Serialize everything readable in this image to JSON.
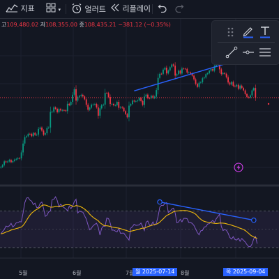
{
  "toolbar": {
    "indicators_label": "지표",
    "alert_label": "얼러트",
    "replay_label": "리플레이"
  },
  "ohlc": {
    "high_prefix": "고",
    "high_value": "109,480.02",
    "low_prefix": "저",
    "low_value": "108,355.00",
    "close_prefix": "종",
    "close_value": "108,435.21",
    "change": "−381.12",
    "change_pct": "(−0.35%)"
  },
  "colors": {
    "background": "#131722",
    "up": "#089981",
    "down": "#f23645",
    "trendline": "#2962ff",
    "rsi_line": "#7e57c2",
    "rsi_ma": "#f0b90b",
    "rsi_band": "#7e57c2"
  },
  "time_axis": {
    "labels": [
      "5월",
      "6월",
      "7월",
      "8월"
    ],
    "left_badge": "월 2025-07-14",
    "right_badge": "목 2025-09-04"
  },
  "icons": [
    "chart-indicators-icon",
    "templates-icon",
    "alarm-clock-icon",
    "replay-icon",
    "undo-icon",
    "redo-icon",
    "grip-icon",
    "pencil-icon",
    "text-icon",
    "trendline-icon",
    "horizontal-ray-icon",
    "fib-icon",
    "lightning-icon"
  ],
  "chart_data": {
    "type": "candlestick",
    "title": "",
    "xlabel": "",
    "ylabel": "",
    "x": [
      "2025-04-09",
      "2025-04-10",
      "2025-04-11",
      "2025-04-12",
      "2025-04-13",
      "2025-04-14",
      "2025-04-15",
      "2025-04-16",
      "2025-04-17",
      "2025-04-18",
      "2025-04-19",
      "2025-04-20",
      "2025-04-21",
      "2025-04-22",
      "2025-04-23",
      "2025-04-24",
      "2025-04-25",
      "2025-04-26",
      "2025-04-27",
      "2025-04-28",
      "2025-04-29",
      "2025-04-30",
      "2025-05-01",
      "2025-05-02",
      "2025-05-03",
      "2025-05-04",
      "2025-05-05",
      "2025-05-06",
      "2025-05-07",
      "2025-05-08",
      "2025-05-09",
      "2025-05-10",
      "2025-05-11",
      "2025-05-12",
      "2025-05-13",
      "2025-05-14",
      "2025-05-15",
      "2025-05-16",
      "2025-05-17",
      "2025-05-18",
      "2025-05-19",
      "2025-05-20",
      "2025-05-21",
      "2025-05-22",
      "2025-05-23",
      "2025-05-24",
      "2025-05-25",
      "2025-05-26",
      "2025-05-27",
      "2025-05-28",
      "2025-05-29",
      "2025-05-30",
      "2025-05-31",
      "2025-06-01",
      "2025-06-02",
      "2025-06-03",
      "2025-06-04",
      "2025-06-05",
      "2025-06-06",
      "2025-06-07",
      "2025-06-08",
      "2025-06-09",
      "2025-06-10",
      "2025-06-11",
      "2025-06-12",
      "2025-06-13",
      "2025-06-14",
      "2025-06-15",
      "2025-06-16",
      "2025-06-17",
      "2025-06-18",
      "2025-06-19",
      "2025-06-20",
      "2025-06-21",
      "2025-06-22",
      "2025-06-23",
      "2025-06-24",
      "2025-06-25",
      "2025-06-26",
      "2025-06-27",
      "2025-06-28",
      "2025-06-29",
      "2025-06-30",
      "2025-07-01",
      "2025-07-02",
      "2025-07-03",
      "2025-07-04",
      "2025-07-05",
      "2025-07-06",
      "2025-07-07",
      "2025-07-08",
      "2025-07-09",
      "2025-07-10",
      "2025-07-11",
      "2025-07-12",
      "2025-07-13",
      "2025-07-14",
      "2025-07-15",
      "2025-07-16",
      "2025-07-17",
      "2025-07-18",
      "2025-07-19",
      "2025-07-20",
      "2025-07-21",
      "2025-07-22",
      "2025-07-23",
      "2025-07-24",
      "2025-07-25",
      "2025-07-26",
      "2025-07-27",
      "2025-07-28",
      "2025-07-29",
      "2025-07-30",
      "2025-07-31",
      "2025-08-01",
      "2025-08-02",
      "2025-08-03",
      "2025-08-04",
      "2025-08-05",
      "2025-08-06",
      "2025-08-07",
      "2025-08-08",
      "2025-08-09",
      "2025-08-10",
      "2025-08-11",
      "2025-08-12",
      "2025-08-13",
      "2025-08-14",
      "2025-08-15",
      "2025-08-16",
      "2025-08-17",
      "2025-08-18",
      "2025-08-19",
      "2025-08-20",
      "2025-08-21",
      "2025-08-22",
      "2025-08-23",
      "2025-08-24",
      "2025-08-25",
      "2025-08-26",
      "2025-08-27",
      "2025-08-28",
      "2025-08-29",
      "2025-08-30",
      "2025-08-31",
      "2025-09-01",
      "2025-09-02",
      "2025-09-03",
      "2025-09-04"
    ],
    "close": [
      82000,
      82744,
      84138,
      83811,
      84108,
      84698,
      83819,
      84262,
      84829,
      85074,
      85359,
      85294,
      87563,
      90941,
      93386,
      93714,
      94635,
      94633,
      93744,
      94980,
      94215,
      94358,
      96516,
      97035,
      95857,
      94318,
      94852,
      96867,
      97050,
      102957,
      103118,
      104703,
      104164,
      102872,
      104110,
      103545,
      103668,
      103592,
      103303,
      106080,
      105588,
      106830,
      109549,
      111617,
      107283,
      108754,
      109084,
      109510,
      108895,
      107782,
      105713,
      103808,
      104603,
      105779,
      105805,
      106017,
      104701,
      101554,
      104338,
      105592,
      105780,
      110232,
      110150,
      108692,
      105996,
      106043,
      105506,
      105514,
      106832,
      104564,
      104796,
      104576,
      103299,
      102176,
      100926,
      105365,
      106011,
      107296,
      106981,
      107076,
      107347,
      108328,
      107106,
      105654,
      108848,
      109574,
      108244,
      108201,
      109185,
      108250,
      108817,
      111315,
      115949,
      117510,
      117492,
      119098,
      119843,
      117649,
      118770,
      120000,
      121070,
      120592,
      116828,
      117381,
      118700,
      117621,
      119525,
      119448,
      119384,
      117969,
      118000,
      117600,
      116800,
      115400,
      113700,
      112500,
      114100,
      114300,
      115800,
      116100,
      117400,
      117700,
      118700,
      119300,
      118700,
      120400,
      121800,
      123300,
      119200,
      117400,
      117800,
      117500,
      116200,
      114200,
      113400,
      114400,
      112900,
      112700,
      113300,
      111800,
      113000,
      112100,
      111200,
      109800,
      108700,
      108455,
      109300,
      111200,
      112100,
      108435
    ],
    "trendlines": [
      {
        "pane": "price",
        "from": [
          "2025-06-26",
          111000
        ],
        "to": [
          "2025-09-04",
          124500
        ]
      },
      {
        "pane": "rsi",
        "from": [
          "2025-07-11",
          80
        ],
        "to": [
          "2025-09-04",
          60
        ]
      }
    ],
    "series": [
      {
        "name": "RSI",
        "values": [
          45.0,
          47.6,
          49.8,
          53.6,
          52.8,
          53.9,
          56.6,
          52.6,
          54.4,
          57.1,
          57.3,
          58.6,
          58.2,
          68.0,
          79.1,
          84.3,
          84.8,
          82.1,
          81.0,
          77.1,
          78.8,
          73.8,
          74.0,
          78.5,
          80.0,
          72.8,
          64.2,
          65.6,
          69.1,
          70.1,
          82.4,
          82.9,
          85.7,
          81.6,
          74.6,
          77.6,
          75.4,
          73.8,
          72.5,
          70.3,
          75.3,
          72.7,
          75.5,
          80.5,
          83.0,
          68.0,
          70.1,
          69.3,
          68.8,
          64.9,
          61.3,
          54.8,
          49.5,
          51.4,
          54.0,
          55.4,
          56.7,
          52.3,
          43.7,
          51.2,
          53.6,
          53.4,
          62.5,
          61.7,
          56.9,
          49.0,
          49.2,
          48.1,
          47.1,
          51.0,
          45.6,
          45.9,
          45.9,
          43.0,
          40.6,
          38.1,
          51.3,
          52.9,
          55.5,
          54.4,
          54.5,
          54.9,
          56.9,
          52.9,
          48.7,
          57.9,
          59.1,
          54.5,
          54.6,
          58.1,
          54.7,
          56.7,
          64.1,
          74.3,
          76.3,
          76.1,
          78.4,
          79.3,
          68.6,
          69.9,
          72.2,
          73.2,
          68.1,
          57.2,
          58.1,
          61.0,
          58.3,
          62.0,
          62.1,
          61.6,
          57.5,
          57.6,
          56.4,
          54.2,
          50.3,
          46.5,
          44.0,
          48.5,
          48.8,
          52.5,
          53.0,
          55.8,
          56.3,
          58.2,
          59.7,
          57.7,
          61.5,
          64.1,
          66.6,
          53.2,
          48.7,
          49.7,
          48.9,
          45.7,
          41.1,
          39.4,
          42.0,
          38.8,
          38.2,
          40.3,
          36.9,
          40.0,
          38.0,
          36.1,
          33.3,
          31.2,
          30.8,
          34.0,
          39.6,
          42.2,
          34.2
        ]
      },
      {
        "name": "RSI-based MA",
        "values": [
          45.0,
          45.5,
          46.1,
          47.0,
          47.6,
          48.3,
          49.2,
          49.6,
          50.2,
          50.9,
          51.3,
          52.0,
          52.5,
          54.2,
          56.8,
          59.8,
          62.8,
          65.5,
          67.8,
          69.3,
          70.8,
          71.9,
          72.9,
          74.4,
          76.1,
          76.8,
          76.6,
          76.1,
          75.2,
          74.3,
          74.4,
          74.6,
          75.0,
          75.0,
          74.7,
          74.9,
          75.6,
          76.5,
          77.0,
          77.0,
          77.0,
          76.3,
          75.2,
          75.1,
          76.2,
          75.7,
          75.3,
          74.5,
          73.5,
          72.2,
          70.7,
          68.9,
          66.7,
          64.8,
          63.2,
          61.8,
          60.7,
          59.4,
          57.2,
          55.9,
          54.7,
          53.9,
          53.9,
          53.6,
          53.1,
          52.5,
          52.2,
          51.9,
          51.6,
          51.4,
          50.8,
          50.2,
          49.6,
          49.0,
          48.4,
          47.7,
          48.0,
          48.4,
          48.8,
          49.3,
          49.7,
          50.2,
          50.9,
          51.3,
          51.3,
          52.1,
          53.0,
          53.6,
          54.1,
          54.8,
          55.3,
          55.7,
          56.5,
          57.9,
          59.8,
          61.5,
          63.4,
          65.2,
          66.1,
          67.1,
          68.1,
          69.2,
          69.9,
          70.1,
          70.3,
          70.6,
          70.6,
          70.7,
          70.6,
          70.4,
          69.9,
          69.4,
          68.7,
          67.8,
          66.6,
          64.7,
          62.6,
          61.1,
          59.6,
          58.8,
          58.3,
          57.9,
          57.4,
          57.1,
          56.9,
          56.6,
          56.4,
          56.6,
          56.9,
          56.9,
          56.8,
          56.6,
          56.1,
          55.6,
          55.2,
          54.6,
          53.9,
          53.3,
          52.8,
          52.0,
          51.2,
          50.6,
          49.8,
          48.7,
          47.2,
          45.6,
          43.9,
          42.6,
          41.6,
          41.0,
          40.0
        ]
      }
    ],
    "rsi_bands": [
      30,
      70
    ],
    "ylim": [
      76000,
      135000
    ],
    "rsi_ylim": [
      20,
      95
    ]
  }
}
